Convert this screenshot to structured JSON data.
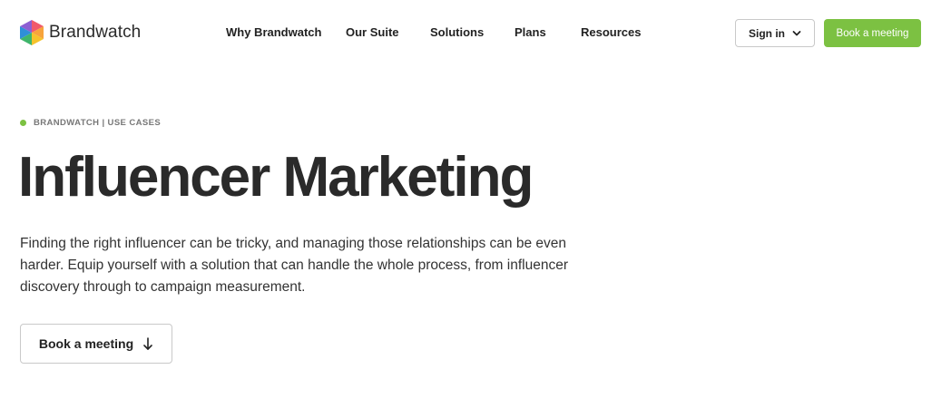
{
  "header": {
    "logo_text": "Brandwatch",
    "nav": [
      {
        "label": "Why Brandwatch"
      },
      {
        "label": "Our Suite"
      },
      {
        "label": "Solutions"
      },
      {
        "label": "Plans"
      },
      {
        "label": "Resources"
      }
    ],
    "signin_label": "Sign in",
    "book_label": "Book a meeting"
  },
  "hero": {
    "eyebrow": "BRANDWATCH | USE CASES",
    "title": "Influencer Marketing",
    "description": "Finding the right influencer can be tricky, and managing those relationships can be even harder. Equip yourself with a solution that can handle the whole process, from influencer discovery through to campaign measurement.",
    "cta_label": "Book a meeting"
  },
  "icons": {
    "logo": "brandwatch-hexagon-logo",
    "signin_chevron": "chevron-down-icon",
    "cta_arrow": "arrow-down-icon"
  },
  "colors": {
    "accent_green": "#7cc142",
    "text_dark": "#2a2a2a",
    "eyebrow_gray": "#777777",
    "border_gray": "#c9c9c9"
  }
}
